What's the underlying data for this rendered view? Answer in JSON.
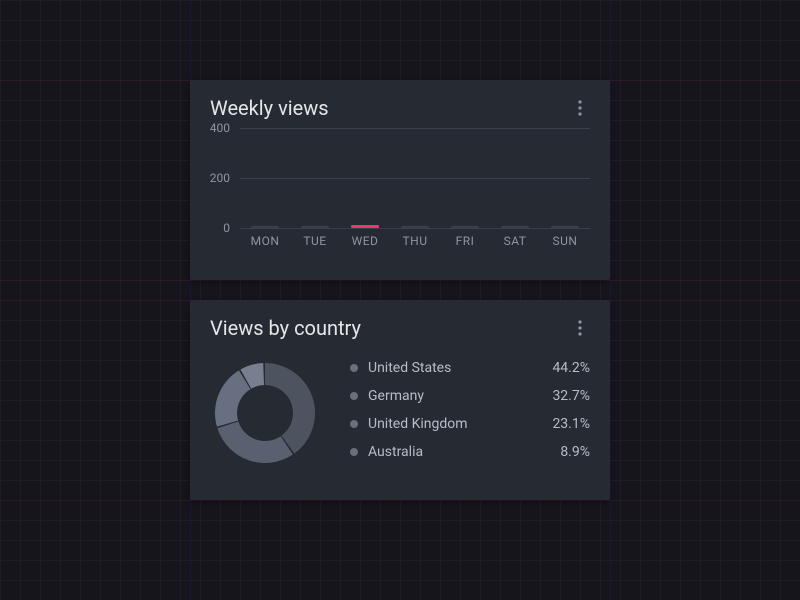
{
  "chart_data": [
    {
      "type": "bar",
      "title": "Weekly views",
      "categories": [
        "MON",
        "TUE",
        "WED",
        "THU",
        "FRI",
        "SAT",
        "SUN"
      ],
      "values": [
        0,
        0,
        0,
        0,
        0,
        0,
        0
      ],
      "active_category": "WED",
      "ylabel": "",
      "xlabel": "",
      "ylim": [
        0,
        400
      ],
      "yticks": [
        0,
        200,
        400
      ]
    },
    {
      "type": "pie",
      "title": "Views by country",
      "series": [
        {
          "name": "United States",
          "value": 44.2
        },
        {
          "name": "Germany",
          "value": 32.7
        },
        {
          "name": "United Kingdom",
          "value": 23.1
        },
        {
          "name": "Australia",
          "value": 8.9
        }
      ],
      "unit": "%"
    }
  ],
  "ui": {
    "card1": {
      "menu_icon": "more-vertical"
    },
    "card2": {
      "menu_icon": "more-vertical"
    }
  }
}
